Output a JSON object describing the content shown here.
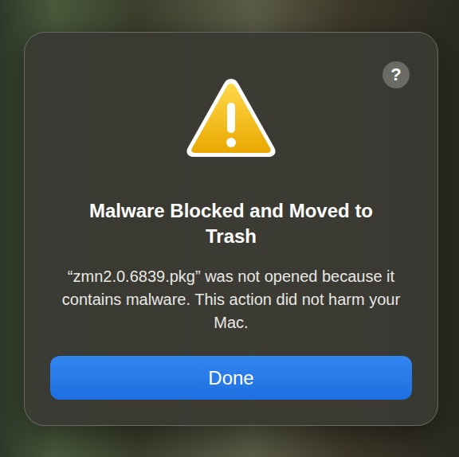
{
  "dialog": {
    "help_button": "?",
    "title": "Malware Blocked and Moved to Trash",
    "message": "“zmn2.0.6839.pkg” was not opened because it contains malware. This action did not harm your Mac."
  },
  "buttons": [
    "Done"
  ]
}
